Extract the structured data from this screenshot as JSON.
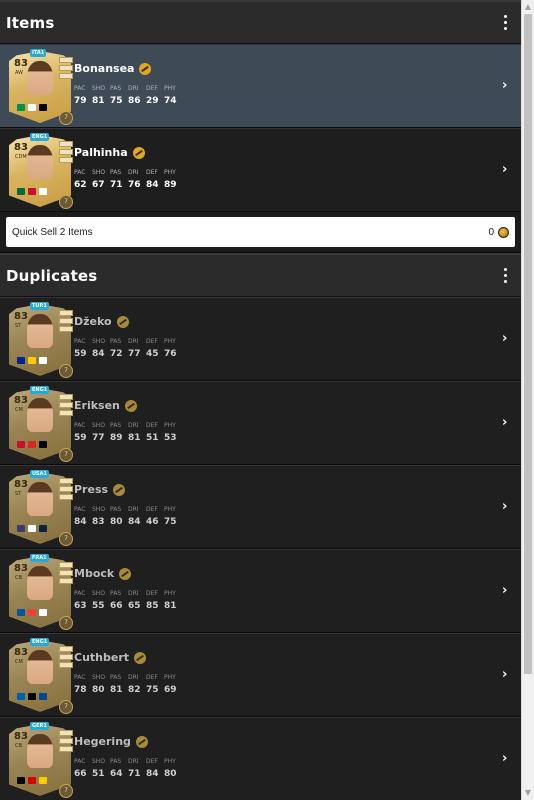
{
  "items_section": {
    "title": "Items",
    "players": [
      {
        "name": "Bonansea",
        "rating": "83",
        "position": "AW",
        "league_badge": "ITA1",
        "stats_labels": [
          "PAC",
          "SHO",
          "PAS",
          "DRI",
          "DEF",
          "PHY"
        ],
        "stats": [
          "79",
          "81",
          "75",
          "86",
          "29",
          "74"
        ],
        "chem": "7",
        "tags": [
          "RM",
          "LW",
          "RW"
        ],
        "flag_colors": [
          "#009246",
          "#ffffff",
          "#000000"
        ],
        "selected": true
      },
      {
        "name": "Palhinha",
        "rating": "83",
        "position": "CDM",
        "league_badge": "ENG1",
        "stats_labels": [
          "PAC",
          "SHO",
          "PAS",
          "DRI",
          "DEF",
          "PHY"
        ],
        "stats": [
          "62",
          "67",
          "71",
          "76",
          "84",
          "89"
        ],
        "chem": "7",
        "tags": [
          "CM",
          "",
          "",
          ""
        ],
        "flag_colors": [
          "#046a38",
          "#c8102e",
          "#ffffff"
        ],
        "selected": false
      }
    ],
    "quick_sell": {
      "label": "Quick Sell 2 Items",
      "value": "0"
    }
  },
  "duplicates_section": {
    "title": "Duplicates",
    "players": [
      {
        "name": "Džeko",
        "rating": "83",
        "position": "ST",
        "league_badge": "TUR1",
        "stats": [
          "59",
          "84",
          "72",
          "77",
          "45",
          "76"
        ],
        "chem": "7",
        "flag_colors": [
          "#002395",
          "#fecb00",
          "#ffffff"
        ]
      },
      {
        "name": "Eriksen",
        "rating": "83",
        "position": "CM",
        "league_badge": "ENG1",
        "stats": [
          "59",
          "77",
          "89",
          "81",
          "51",
          "53"
        ],
        "chem": "7",
        "flag_colors": [
          "#c8102e",
          "#da291c",
          "#000000"
        ]
      },
      {
        "name": "Press",
        "rating": "83",
        "position": "ST",
        "league_badge": "USA1",
        "stats": [
          "84",
          "83",
          "80",
          "84",
          "46",
          "75"
        ],
        "chem": "7",
        "flag_colors": [
          "#3c3b6e",
          "#ffffff",
          "#0a2240"
        ]
      },
      {
        "name": "Mbock",
        "rating": "83",
        "position": "CB",
        "league_badge": "FRA1",
        "stats": [
          "63",
          "55",
          "66",
          "65",
          "85",
          "81"
        ],
        "chem": "7",
        "flag_colors": [
          "#0055a4",
          "#ef4135",
          "#ffffff"
        ]
      },
      {
        "name": "Cuthbert",
        "rating": "83",
        "position": "CM",
        "league_badge": "ENG1",
        "stats": [
          "78",
          "80",
          "81",
          "82",
          "75",
          "69"
        ],
        "chem": "7",
        "flag_colors": [
          "#005eb8",
          "#000000",
          "#034694"
        ]
      },
      {
        "name": "Hegering",
        "rating": "83",
        "position": "CB",
        "league_badge": "GER1",
        "stats": [
          "66",
          "51",
          "64",
          "71",
          "84",
          "80"
        ],
        "chem": "7",
        "flag_colors": [
          "#000000",
          "#dd0000",
          "#ffcc00"
        ]
      }
    ],
    "stats_labels": [
      "PAC",
      "SHO",
      "PAS",
      "DRI",
      "DEF",
      "PHY"
    ]
  }
}
